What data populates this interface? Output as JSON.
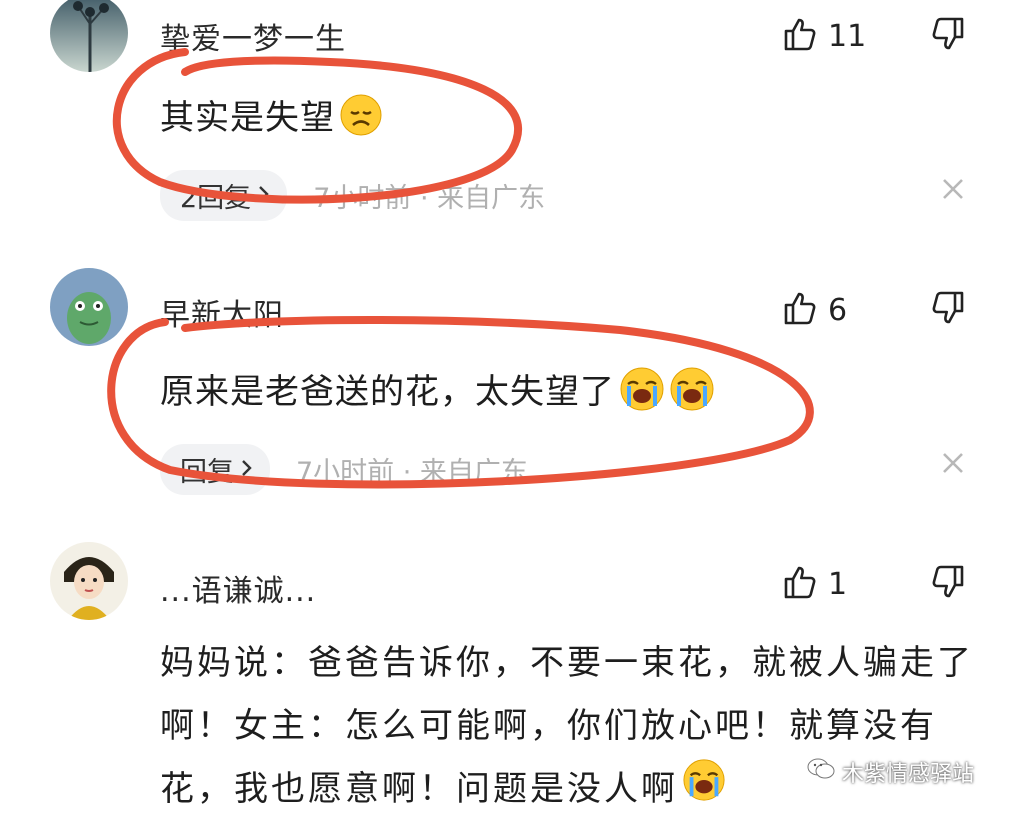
{
  "comments": [
    {
      "username": "挚爱一梦一生",
      "likes": "11",
      "content": "其实是失望",
      "emoji": "disappointed-face",
      "reply_label": "2回复",
      "time_location": "7小时前 · 来自广东"
    },
    {
      "username": "早新太阳",
      "likes": "6",
      "content": "原来是老爸送的花，太失望了",
      "emoji": "loudly-crying-face",
      "reply_label": "回复",
      "time_location": "7小时前 · 来自广东"
    },
    {
      "username": "...语谦诚...",
      "likes": "1",
      "content": "妈妈说：爸爸告诉你，不要一束花，就被人骗走了啊！女主：怎么可能啊，你们放心吧！就算没有花，我也愿意啊！问题是没人啊",
      "emoji": "loudly-crying-face"
    }
  ],
  "watermark": "木紫情感驿站",
  "colors": {
    "annotation": "#e8533a",
    "meta": "#b0b0b0",
    "reply_bg": "#f1f2f4"
  }
}
